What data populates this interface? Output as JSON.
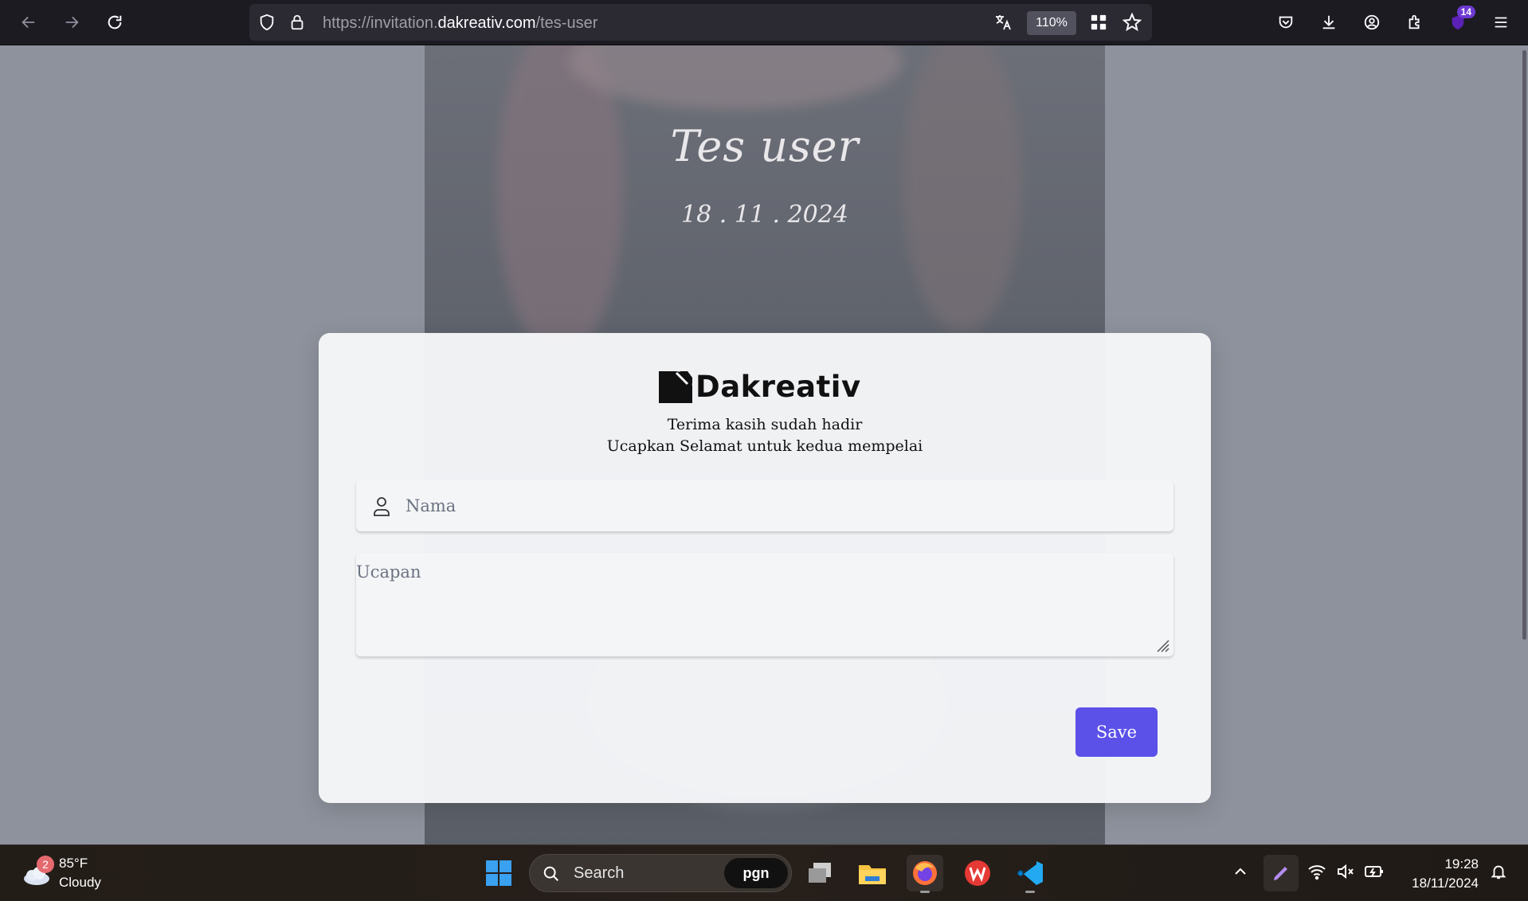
{
  "browser": {
    "url_prefix": "https://invitation.",
    "url_domain": "dakreativ.com",
    "url_path": "/tes-user",
    "zoom_level": "110%",
    "extension_badge_count": "14"
  },
  "invitation": {
    "title": "Tes user",
    "date": "18 . 11 . 2024"
  },
  "modal": {
    "logo_text": "Dakreativ",
    "thanks_line": "Terima kasih sudah hadir",
    "prompt_line": "Ucapkan Selamat untuk kedua mempelai",
    "name_placeholder": "Nama",
    "message_placeholder": "Ucapan",
    "save_label": "Save",
    "accent_color": "#5b50e8"
  },
  "taskbar": {
    "weather_badge": "2",
    "temperature": "85°F",
    "condition": "Cloudy",
    "search_label": "Search",
    "search_badge_text": "pgn",
    "time": "19:28",
    "date": "18/11/2024"
  }
}
